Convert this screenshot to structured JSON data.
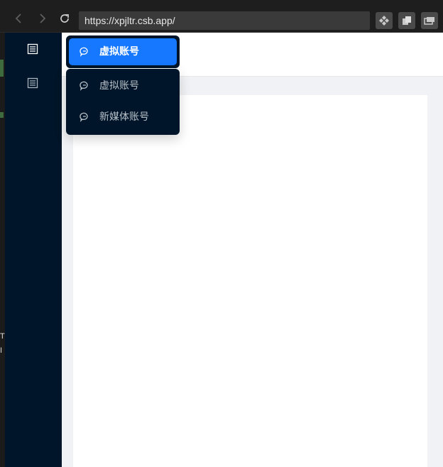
{
  "browser": {
    "url": "https://xpjltr.csb.app/"
  },
  "outer_strip": {
    "text_1": "T",
    "text_2": "I"
  },
  "sidebar": {
    "items": [
      {
        "icon": "list-icon",
        "active": true
      },
      {
        "icon": "list-icon",
        "active": false
      }
    ]
  },
  "menu": {
    "active_label": "虚拟账号",
    "items": [
      {
        "label": "虚拟账号",
        "icon": "chat-icon"
      },
      {
        "label": "新媒体账号",
        "icon": "chat-icon"
      }
    ]
  },
  "colors": {
    "sidebar_bg": "#001529",
    "accent": "#1677ff",
    "content_bg": "#f0f2f5"
  }
}
